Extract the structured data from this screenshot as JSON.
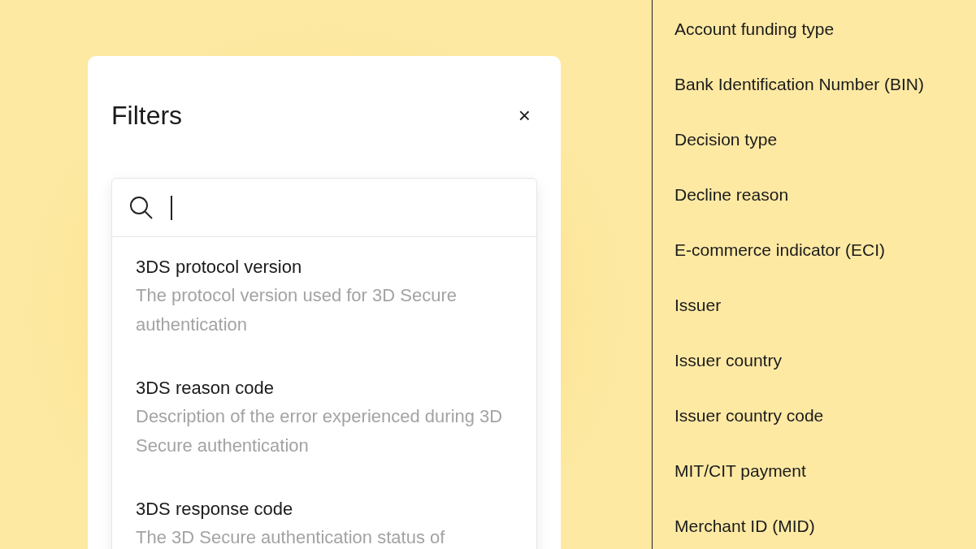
{
  "filters_panel": {
    "title": "Filters",
    "close": "×",
    "search": {
      "focused": true
    },
    "options": [
      {
        "name": "3DS protocol version",
        "description": "The protocol version used for 3D Secure authentication"
      },
      {
        "name": "3DS reason code",
        "description": "Description of the error experienced during 3D Secure authentication"
      },
      {
        "name": "3DS response code",
        "description": "The 3D Secure authentication status of"
      }
    ]
  },
  "field_list": [
    "Account funding type",
    "Bank Identification Number (BIN)",
    "Decision type",
    "Decline reason",
    "E-commerce indicator (ECI)",
    "Issuer",
    "Issuer country",
    "Issuer country code",
    "MIT/CIT payment",
    "Merchant ID (MID)"
  ]
}
